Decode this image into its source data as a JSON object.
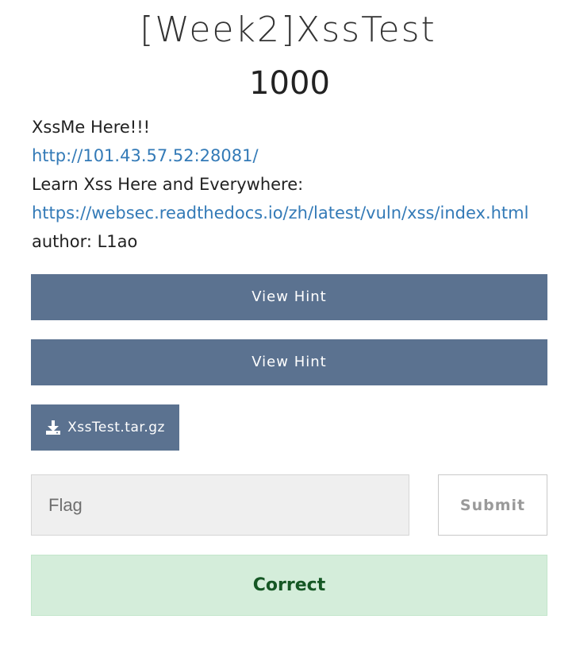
{
  "challenge": {
    "title": "[Week2]XssTest",
    "points": "1000",
    "description": {
      "line1": "XssMe Here!!!",
      "link1": "http://101.43.57.52:28081/",
      "line2": "Learn Xss Here and Everywhere:",
      "link2": "https://websec.readthedocs.io/zh/latest/vuln/xss/index.html",
      "line3": "author: L1ao"
    }
  },
  "hints": [
    {
      "label": "View Hint"
    },
    {
      "label": "View Hint"
    }
  ],
  "file": {
    "label": "XssTest.tar.gz",
    "icon": "download-icon"
  },
  "flag_form": {
    "placeholder": "Flag",
    "value": "",
    "submit_label": "Submit"
  },
  "result": {
    "message": "Correct",
    "status_color": "#d4edda",
    "text_color": "#155724"
  },
  "colors": {
    "button_bg": "#5b7290",
    "link": "#337ab7"
  }
}
